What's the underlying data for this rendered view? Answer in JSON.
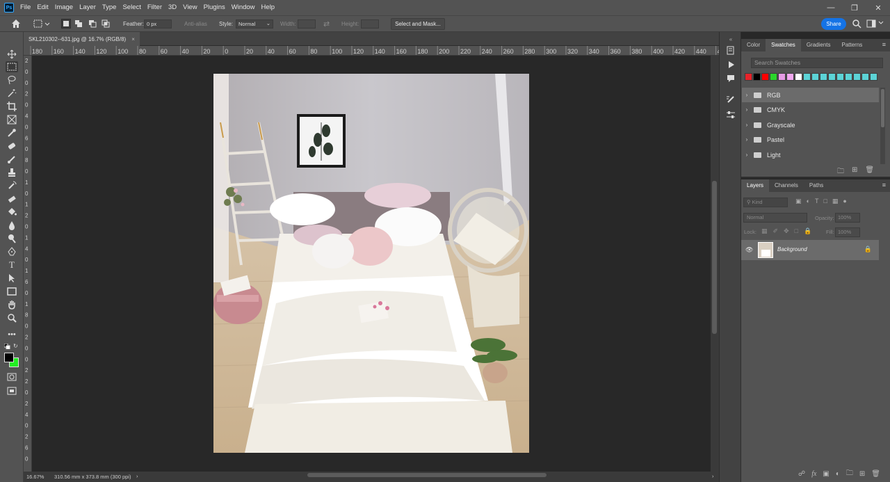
{
  "menubar": {
    "logo": "Ps",
    "items": [
      "File",
      "Edit",
      "Image",
      "Layer",
      "Type",
      "Select",
      "Filter",
      "3D",
      "View",
      "Plugins",
      "Window",
      "Help"
    ]
  },
  "options": {
    "feather_label": "Feather:",
    "feather_value": "0 px",
    "anti_alias": "Anti-alias",
    "style_label": "Style:",
    "style_value": "Normal",
    "width_label": "Width:",
    "height_label": "Height:",
    "select_mask": "Select and Mask...",
    "share": "Share"
  },
  "document": {
    "tab_title": "SKL210302--631.jpg @ 16.7% (RGB/8)",
    "close": "×"
  },
  "rulers": {
    "horizontal": [
      "180",
      "160",
      "140",
      "120",
      "100",
      "80",
      "60",
      "40",
      "20",
      "0",
      "20",
      "40",
      "60",
      "80",
      "100",
      "120",
      "140",
      "160",
      "180",
      "200",
      "220",
      "240",
      "260",
      "280",
      "300",
      "320",
      "340",
      "360",
      "380",
      "400",
      "420",
      "440",
      "460",
      "480"
    ],
    "vertical": [
      "2",
      "0",
      "0",
      "2",
      "0",
      "4",
      "0",
      "6",
      "0",
      "8",
      "0",
      "1",
      "0",
      "1",
      "2",
      "0",
      "1",
      "4",
      "0",
      "1",
      "6",
      "0",
      "1",
      "8",
      "0",
      "2",
      "0",
      "0",
      "2",
      "2",
      "0",
      "2",
      "4",
      "0",
      "2",
      "6",
      "0"
    ]
  },
  "statusbar": {
    "zoom": "16.67%",
    "dimensions": "310.56 mm x 373.8 mm (300 ppi)"
  },
  "swatches_panel": {
    "tabs": [
      "Color",
      "Swatches",
      "Gradients",
      "Patterns"
    ],
    "active_tab": "Swatches",
    "search_placeholder": "Search Swatches",
    "colors": [
      "#e8232a",
      "#000000",
      "#ff0000",
      "#2bd52b",
      "#e79be6",
      "#f2a8f0",
      "#ffffff",
      "#5cd3d6",
      "#5cd3d6",
      "#5cd3d6",
      "#5cd3d6",
      "#5cd3d6",
      "#5cd3d6",
      "#5cd3d6",
      "#5cd3d6",
      "#5cd3d6"
    ],
    "groups": [
      "RGB",
      "CMYK",
      "Grayscale",
      "Pastel",
      "Light"
    ]
  },
  "layers_panel": {
    "tabs": [
      "Layers",
      "Channels",
      "Paths"
    ],
    "kind_placeholder": "Kind",
    "blend_mode": "Normal",
    "opacity_label": "Opacity:",
    "opacity_value": "100%",
    "lock_label": "Lock:",
    "fill_label": "Fill:",
    "fill_value": "100%",
    "layer_name": "Background"
  }
}
